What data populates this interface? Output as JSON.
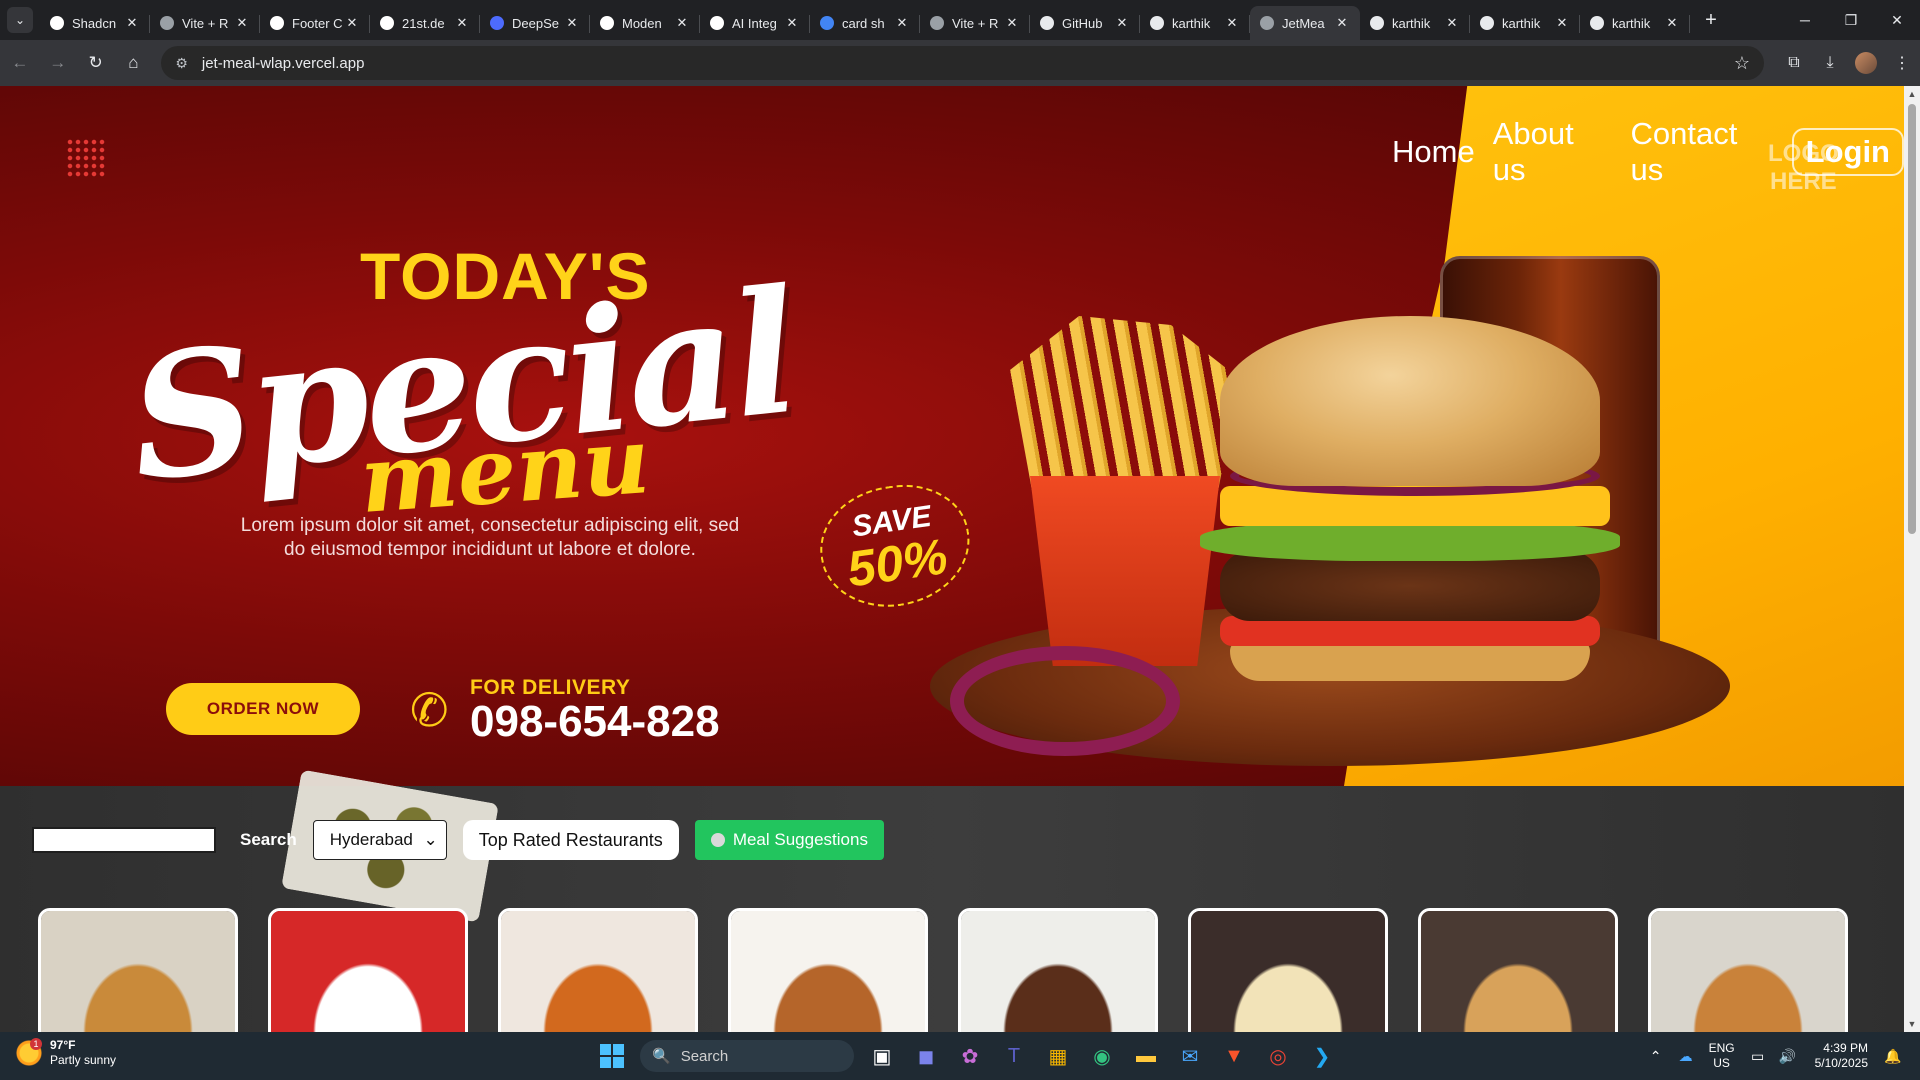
{
  "browser": {
    "tabs": [
      {
        "title": "Shadcn",
        "favicon_color": "#ffffff",
        "active": false
      },
      {
        "title": "Vite + R",
        "favicon_color": "#9aa0a6",
        "active": false
      },
      {
        "title": "Footer C",
        "favicon_color": "#ffffff",
        "active": false
      },
      {
        "title": "21st.de",
        "favicon_color": "#ffffff",
        "active": false
      },
      {
        "title": "DeepSe",
        "favicon_color": "#4d6bfe",
        "active": false
      },
      {
        "title": "Moden",
        "favicon_color": "#ffffff",
        "active": false
      },
      {
        "title": "AI Integ",
        "favicon_color": "#ffffff",
        "active": false
      },
      {
        "title": "card sh",
        "favicon_color": "#4285f4",
        "active": false
      },
      {
        "title": "Vite + R",
        "favicon_color": "#9aa0a6",
        "active": false
      },
      {
        "title": "GitHub",
        "favicon_color": "#e8eaed",
        "active": false
      },
      {
        "title": "karthik",
        "favicon_color": "#e8eaed",
        "active": false
      },
      {
        "title": "JetMea",
        "favicon_color": "#9aa0a6",
        "active": true
      },
      {
        "title": "karthik",
        "favicon_color": "#e8eaed",
        "active": false
      },
      {
        "title": "karthik",
        "favicon_color": "#e8eaed",
        "active": false
      },
      {
        "title": "karthik",
        "favicon_color": "#e8eaed",
        "active": false
      }
    ],
    "url": "jet-meal-wlap.vercel.app"
  },
  "nav": {
    "home": "Home",
    "about": "About us",
    "contact": "Contact us",
    "login": "Login"
  },
  "hero": {
    "title": "TODAY'S",
    "special": "Special",
    "menu": "menu",
    "description": "Lorem ipsum dolor sit amet, consectetur adipiscing elit, sed do eiusmod tempor incididunt ut labore et dolore.",
    "save_label": "SAVE",
    "save_value": "50%",
    "order_button": "ORDER NOW",
    "delivery_label": "FOR DELIVERY",
    "phone": "098-654-828",
    "logo_placeholder_1": "LOGO",
    "logo_placeholder_2": "HERE"
  },
  "controls": {
    "search_value": "",
    "search_label": "Search",
    "city": "Hyderabad",
    "top_rated": "Top Rated Restaurants",
    "meal_suggestions": "Meal Suggestions"
  },
  "restaurants": [
    {
      "image": "biryani plate",
      "bg": "#d9d2c4",
      "accent": "#c98a3a"
    },
    {
      "image": "KFC bucket meal",
      "bg": "#d62828",
      "accent": "#ffffff"
    },
    {
      "image": "platter spread",
      "bg": "#efe7df",
      "accent": "#d2691e"
    },
    {
      "image": "chicken biryani pot",
      "bg": "#f6f3ee",
      "accent": "#b5652a"
    },
    {
      "image": "dessert bowls",
      "bg": "#eeeeea",
      "accent": "#5a2e1a"
    },
    {
      "image": "rice bowl with rose",
      "bg": "#3b2d2a",
      "accent": "#f2e3b8"
    },
    {
      "image": "biryani with curry",
      "bg": "#4a3a33",
      "accent": "#d8a25a"
    },
    {
      "image": "biryani platter",
      "bg": "#d9d5cc",
      "accent": "#c9823a"
    }
  ],
  "taskbar": {
    "temperature": "97°F",
    "weather": "Partly sunny",
    "weather_badge": "1",
    "search": "Search",
    "lang_1": "ENG",
    "lang_2": "US",
    "time": "4:39 PM",
    "date": "5/10/2025"
  }
}
